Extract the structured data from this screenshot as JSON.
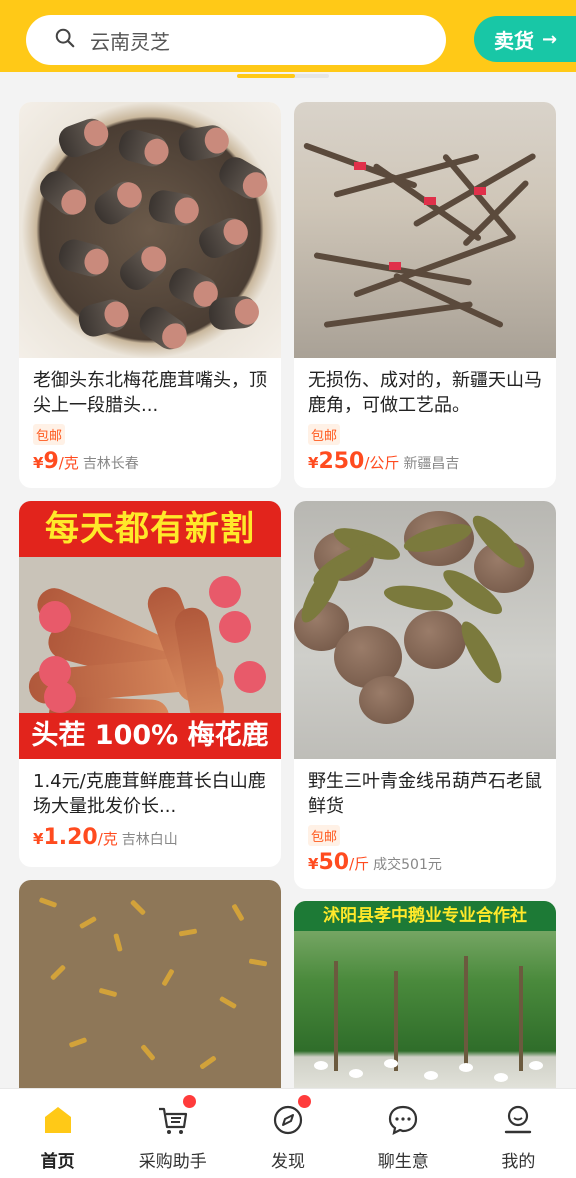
{
  "search": {
    "query": "云南灵芝"
  },
  "sell_button": {
    "label": "卖货"
  },
  "cards": [
    {
      "title": "老御头东北梅花鹿茸嘴头，顶尖上一段腊头...",
      "tag": "包邮",
      "currency": "¥",
      "price": "9",
      "unit": "/克",
      "location": "吉林长春"
    },
    {
      "title": "无损伤、成对的，新疆天山马鹿角，可做工艺品。",
      "tag": "包邮",
      "currency": "¥",
      "price": "250",
      "unit": "/公斤",
      "location": "新疆昌吉"
    },
    {
      "title": "1.4元/克鹿茸鲜鹿茸长白山鹿场大量批发价长...",
      "currency": "¥",
      "price": "1.20",
      "unit": "/克",
      "location": "吉林白山",
      "image_text_top": "每天都有新割",
      "image_text_bottom": "头茬 100% 梅花鹿"
    },
    {
      "title": "野生三叶青金线吊葫芦石老鼠鲜货",
      "tag": "包邮",
      "currency": "¥",
      "price": "50",
      "unit": "/斤",
      "location": "成交501元"
    },
    {
      "title": ""
    },
    {
      "title": "",
      "image_text_top": "沭阳县孝中鹅业专业合作社"
    }
  ],
  "nav": [
    {
      "label": "首页",
      "icon": "home-icon",
      "active": true
    },
    {
      "label": "采购助手",
      "icon": "cart-icon",
      "badge": true
    },
    {
      "label": "发现",
      "icon": "compass-icon",
      "badge": true
    },
    {
      "label": "聊生意",
      "icon": "chat-icon"
    },
    {
      "label": "我的",
      "icon": "profile-icon"
    }
  ],
  "colors": {
    "brand_yellow": "#ffc917",
    "sell_green": "#18c7a6",
    "price_red": "#ff4b1f"
  }
}
